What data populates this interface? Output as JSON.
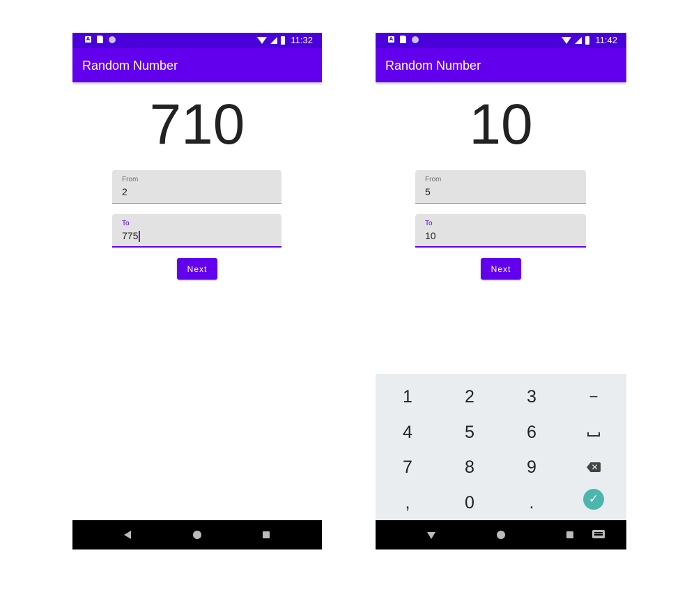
{
  "screens": [
    {
      "status_time": "11:32",
      "app_title": "Random Number",
      "display_number": "710",
      "from": {
        "label": "From",
        "value": "2"
      },
      "to": {
        "label": "To",
        "value": "775"
      },
      "next_label": "Next"
    },
    {
      "status_time": "11:42",
      "app_title": "Random Number",
      "display_number": "10",
      "from": {
        "label": "From",
        "value": "5"
      },
      "to": {
        "label": "To",
        "value": "10"
      },
      "next_label": "Next"
    }
  ],
  "status_icons": {
    "a_badge": "A"
  },
  "keyboard": {
    "keys": [
      "1",
      "2",
      "3",
      "−",
      "4",
      "5",
      "6",
      "␣",
      "7",
      "8",
      "9",
      "⌫",
      ",",
      "0",
      ".",
      "✓"
    ],
    "backspace_glyph": "✕",
    "done_glyph": "✓"
  },
  "colors": {
    "status_bar": "#4a00d9",
    "app_bar": "#6200ee",
    "accent": "#6200ee",
    "keyboard_bg": "#e9edf0",
    "done_key": "#4db6ac"
  }
}
